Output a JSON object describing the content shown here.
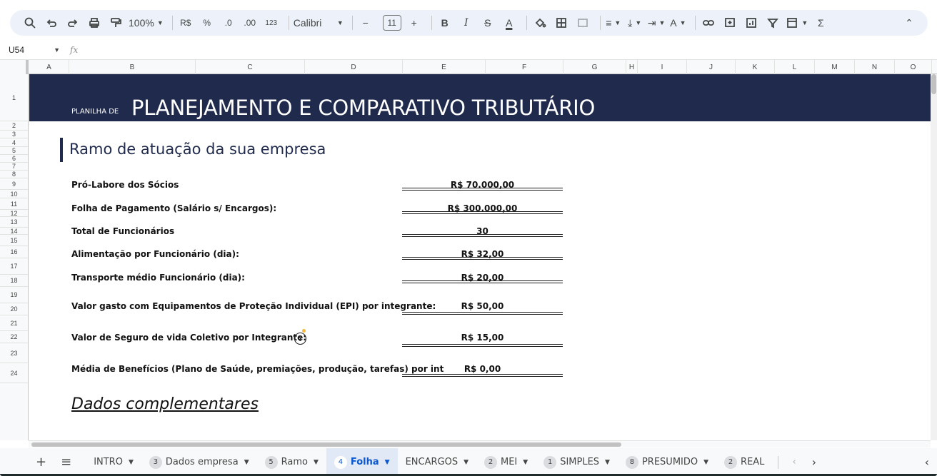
{
  "toolbar": {
    "zoom": "100%",
    "currency": "R$",
    "percent": "%",
    "dec_decrease": ".0",
    "dec_increase": ".00",
    "number_format": "123",
    "font": "Calibri",
    "font_size": "11",
    "bold": "B",
    "italic": "I",
    "text_color_glyph": "A"
  },
  "formula_bar": {
    "cell_ref": "U54",
    "fx": "fx"
  },
  "columns": [
    "A",
    "B",
    "C",
    "D",
    "E",
    "F",
    "G",
    "H",
    "I",
    "J",
    "K",
    "L",
    "M",
    "N",
    "O"
  ],
  "rows": [
    "1",
    "2",
    "3",
    "4",
    "5",
    "6",
    "7",
    "8",
    "9",
    "10",
    "11",
    "12",
    "13",
    "14",
    "15",
    "16",
    "17",
    "18",
    "19",
    "20",
    "21",
    "22",
    "23",
    "24"
  ],
  "sheet": {
    "banner_small": "PLANILHA DE",
    "banner_big": "PLANEJAMENTO E COMPARATIVO TRIBUTÁRIO",
    "section_title": "Ramo de atuação da sua empresa",
    "fields": [
      {
        "label": "Pró-Labore dos Sócios",
        "value": "R$ 70.000,00"
      },
      {
        "label": "Folha de Pagamento (Salário s/ Encargos):",
        "value": "R$ 300.000,00"
      },
      {
        "label": "Total de Funcionários",
        "value": "30"
      },
      {
        "label": "Alimentação por Funcionário (dia):",
        "value": "R$ 32,00"
      },
      {
        "label": "Transporte médio Funcionário (dia):",
        "value": "R$ 20,00"
      },
      {
        "label": "Valor gasto com Equipamentos de Proteção Individual (EPI) por integrante:",
        "value": "R$ 50,00"
      },
      {
        "label": "Valor de Seguro de vida Coletivo por Integrante:",
        "value": "R$ 15,00"
      },
      {
        "label": "Média de Benefícios (Plano de Saúde, premiações, produção, tarefas) por int",
        "value": "R$ 0,00"
      }
    ],
    "help_glyph": "?",
    "complementary_title": "Dados complementares"
  },
  "tabs": [
    {
      "badge": "",
      "label": "INTRO",
      "active": false
    },
    {
      "badge": "3",
      "label": "Dados empresa",
      "active": false
    },
    {
      "badge": "5",
      "label": "Ramo",
      "active": false
    },
    {
      "badge": "4",
      "label": "Folha",
      "active": true
    },
    {
      "badge": "",
      "label": "ENCARGOS",
      "active": false
    },
    {
      "badge": "2",
      "label": "MEI",
      "active": false
    },
    {
      "badge": "1",
      "label": "SIMPLES",
      "active": false
    },
    {
      "badge": "8",
      "label": "PRESUMIDO",
      "active": false
    },
    {
      "badge": "2",
      "label": "REAL",
      "active": false
    }
  ],
  "colors": {
    "banner": "#1f2a4d",
    "active_tab": "#0b57d0",
    "toolbar_bg": "#edf2fa"
  }
}
